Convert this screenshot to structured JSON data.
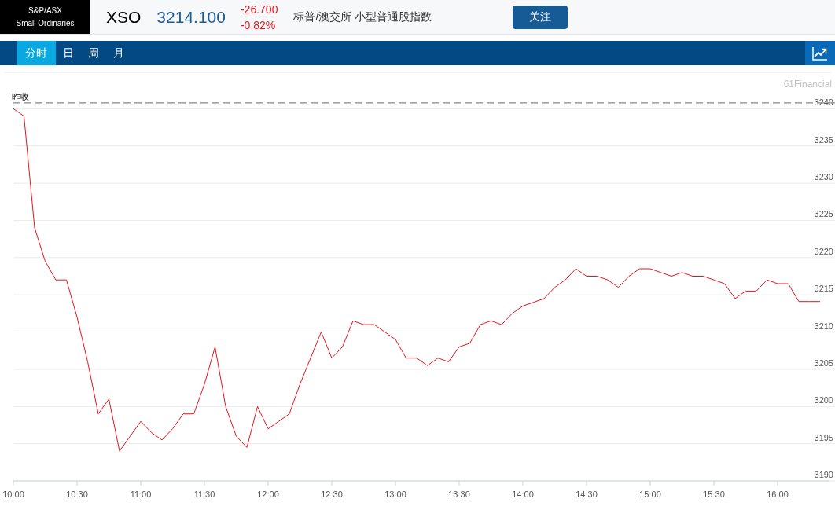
{
  "header": {
    "logo_lines": [
      "S&P/ASX",
      "Small Ordinaries"
    ],
    "symbol": "XSO",
    "price": "3214.100",
    "change": "-26.700",
    "change_pct": "-0.82%",
    "name": "标普/澳交所 小型普通股指数",
    "follow_button": "关注"
  },
  "tabs": [
    {
      "label": "分时",
      "selected": true
    },
    {
      "label": "日",
      "selected": false
    },
    {
      "label": "周",
      "selected": false
    },
    {
      "label": "月",
      "selected": false
    }
  ],
  "chart": {
    "brand": "61Financial",
    "chart_data": {
      "type": "line",
      "categories": [
        "10:00",
        null,
        null,
        null,
        null,
        null,
        "10:30",
        null,
        null,
        null,
        null,
        null,
        "11:00",
        null,
        null,
        null,
        null,
        null,
        "11:30",
        null,
        null,
        null,
        null,
        null,
        "12:00",
        null,
        null,
        null,
        null,
        null,
        "12:30",
        null,
        null,
        null,
        null,
        null,
        "13:00",
        null,
        null,
        null,
        null,
        null,
        "13:30",
        null,
        null,
        null,
        null,
        null,
        "14:00",
        null,
        null,
        null,
        null,
        null,
        "14:30",
        null,
        null,
        null,
        null,
        null,
        "15:00",
        null,
        null,
        null,
        null,
        null,
        "15:30",
        null,
        null,
        null,
        null,
        null,
        "16:00",
        null,
        null,
        null,
        null
      ],
      "series": [
        {
          "color": "#e8141c",
          "values": [
            3240,
            3239,
            3224,
            3219.5,
            3217,
            3217,
            3212,
            3206,
            3199,
            3201,
            3194,
            3196,
            3198,
            3196.5,
            3195.5,
            3197,
            3199,
            3199,
            3203,
            3208,
            3200,
            3196,
            3194.5,
            3200,
            3197,
            3198,
            3199,
            3203,
            3206.5,
            3210,
            3206.5,
            3208,
            3211.5,
            3211,
            3211,
            3210,
            3209,
            3206.5,
            3206.5,
            3205.5,
            3206.5,
            3206,
            3208,
            3208.5,
            3211,
            3211.5,
            3211,
            3212.5,
            3213.5,
            3214,
            3214.5,
            3216,
            3217,
            3218.5,
            3217.5,
            3217.5,
            3217,
            3216,
            3217.5,
            3218.5,
            3218.5,
            3218,
            3217.5,
            3218,
            3217.5,
            3217.5,
            3217,
            3216.5,
            3214.5,
            3215.5,
            3215.5,
            3217,
            3216.5,
            3216.5,
            3214.1,
            3214.1,
            3214.1
          ]
        }
      ],
      "grid": true,
      "ylim": [
        3190,
        3245
      ],
      "yticks": [
        3190,
        3195,
        3200,
        3205,
        3210,
        3215,
        3220,
        3225,
        3230,
        3235,
        3240
      ],
      "ref_lines": [
        {
          "axis": "y",
          "value": 3240.8,
          "label": "昨收"
        }
      ]
    }
  }
}
